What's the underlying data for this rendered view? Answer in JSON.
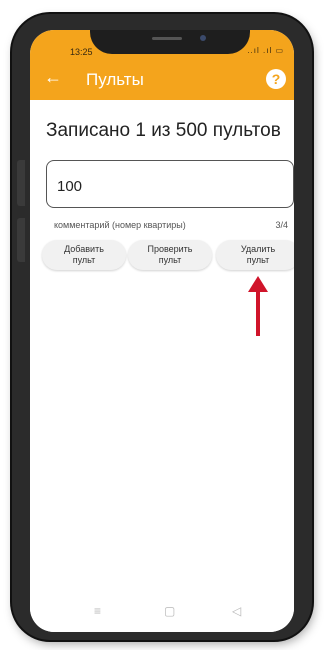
{
  "status_bar": {
    "time": "13:25",
    "icons": "..ıl .ıl ▭"
  },
  "app_bar": {
    "back_icon": "←",
    "title": "Пульты",
    "help_icon": "?"
  },
  "main": {
    "heading": "Записано 1 из 500 пультов",
    "input": {
      "value": "100",
      "helper": "комментарий (номер квартиры)",
      "counter": "3/4"
    },
    "buttons": {
      "add": "Добавить пульт",
      "check": "Проверить пульт",
      "delete": "Удалить пульт"
    }
  },
  "nav_bar": {
    "menu_icon": "≡",
    "home_icon": "▢",
    "back_icon": "◁"
  },
  "colors": {
    "accent": "#f4a41c",
    "annotation_arrow": "#d0142a"
  }
}
